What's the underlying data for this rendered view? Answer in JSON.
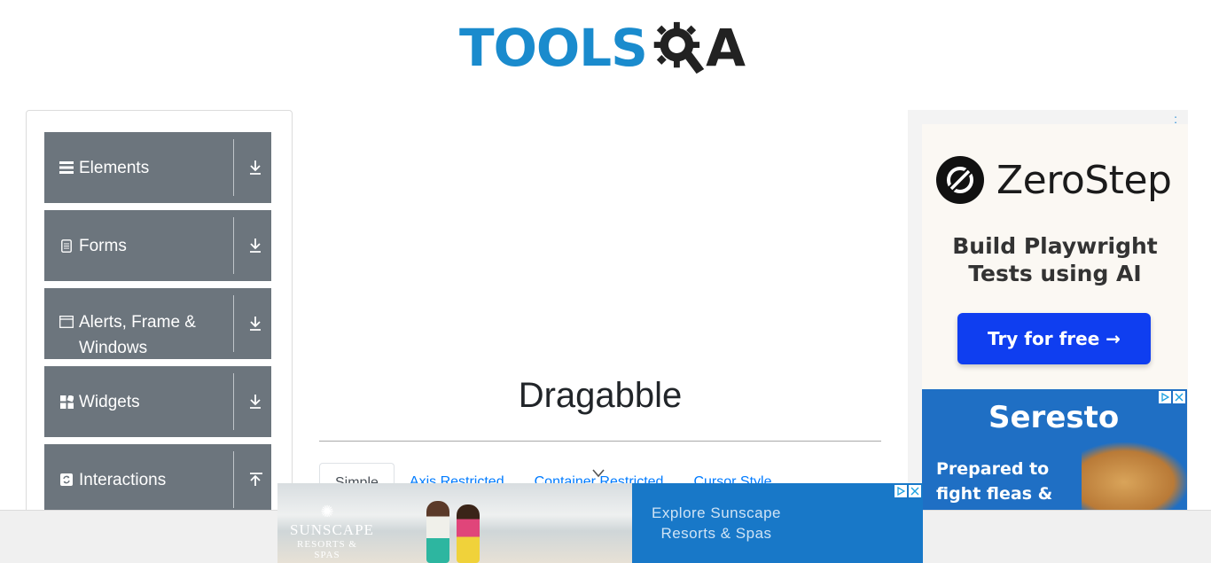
{
  "header": {
    "logo_text_left": "TOOLS",
    "logo_text_right": "A"
  },
  "sidebar": {
    "groups": [
      {
        "label": "Elements",
        "icon": "hamburger-icon",
        "arrow": "download-arrow-icon"
      },
      {
        "label": "Forms",
        "icon": "document-icon",
        "arrow": "download-arrow-icon"
      },
      {
        "label": "Alerts, Frame & Windows",
        "icon": "window-icon",
        "arrow": "download-arrow-icon"
      },
      {
        "label": "Widgets",
        "icon": "widgets-icon",
        "arrow": "download-arrow-icon"
      },
      {
        "label": "Interactions",
        "icon": "refresh-icon",
        "arrow": "upload-arrow-icon"
      }
    ]
  },
  "main": {
    "title": "Dragabble",
    "tabs": [
      {
        "label": "Simple",
        "active": true
      },
      {
        "label": "Axis Restricted",
        "active": false
      },
      {
        "label": "Container Restricted",
        "active": false
      },
      {
        "label": "Cursor Style",
        "active": false
      }
    ]
  },
  "ads": {
    "zerostep": {
      "brand": "ZeroStep",
      "headline": "Build Playwright Tests using AI",
      "cta": "Try for free →",
      "dots": ":"
    },
    "seresto": {
      "brand": "Seresto",
      "tagline": "Prepared to fight fleas &"
    },
    "sunscape": {
      "brand_line1": "SUNSCAPE",
      "brand_line2": "RESORTS & SPAS",
      "cta": "Explore Sunscape Resorts & Spas"
    }
  },
  "colors": {
    "sidebar_bg": "#6c757d",
    "link": "#007bff",
    "logo_blue": "#1a8bcd",
    "zerostep_cta": "#0f3ef0",
    "seresto_bg": "#1f6fc4",
    "sunscape_bg": "#1878c8"
  }
}
